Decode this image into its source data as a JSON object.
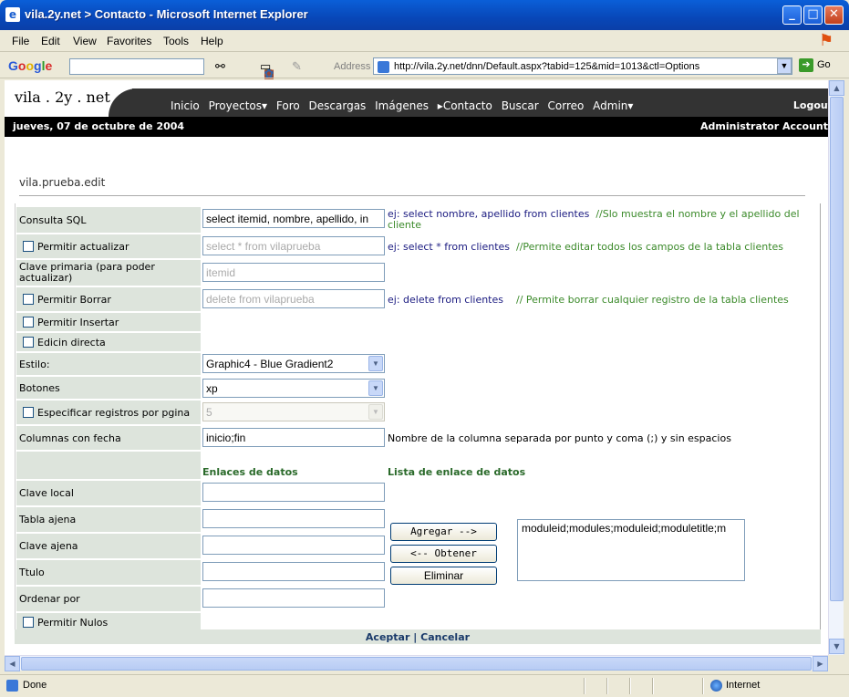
{
  "window": {
    "title": "vila.2y.net > Contacto - Microsoft Internet Explorer",
    "min": "_",
    "max": "□",
    "close": "✕"
  },
  "menu": [
    "File",
    "Edit",
    "View",
    "Favorites",
    "Tools",
    "Help"
  ],
  "google": {
    "label": "Google"
  },
  "address": {
    "label": "Address",
    "url": "http://vila.2y.net/dnn/Default.aspx?tabid=125&mid=1013&ctl=Options",
    "go": "Go"
  },
  "site": {
    "name": "vila . 2y . net",
    "nav": [
      "Inicio",
      "Proyectos▾",
      "Foro",
      "Descargas",
      "Imágenes",
      "▸Contacto",
      "Buscar",
      "Correo",
      "Admin▾"
    ],
    "logout": "Logout",
    "date": "jueves, 07 de octubre de 2004",
    "account": "Administrator Account"
  },
  "module": {
    "title": "vila.prueba.edit"
  },
  "form": {
    "consulta_label": "Consulta SQL",
    "consulta_value": "select itemid, nombre, apellido, in",
    "consulta_ej_prefix": "ej:",
    "consulta_ej_q": "select nombre, apellido from clientes",
    "consulta_ej_c": "//Slo muestra el nombre y el apellido del",
    "consulta_ej_c2": "cliente",
    "actualizar_label": "Permitir actualizar",
    "actualizar_value": "select * from vilaprueba",
    "actualizar_ej_q": "select * from clientes",
    "actualizar_ej_c": "//Permite editar todos los campos de la tabla clientes",
    "clave_label": "Clave primaria (para poder actualizar)",
    "clave_value": "itemid",
    "borrar_label": "Permitir Borrar",
    "borrar_value": "delete from vilaprueba",
    "borrar_ej_q": "delete from clientes",
    "borrar_ej_c": "// Permite borrar cualquier registro de la tabla clientes",
    "insertar_label": "Permitir Insertar",
    "edicion_label": "Edicin directa",
    "estilo_label": "Estilo:",
    "estilo_value": "Graphic4 - Blue Gradient2",
    "botones_label": "Botones",
    "botones_value": "xp",
    "registros_label": "Especificar registros por pgina",
    "registros_value": "5",
    "fecha_label": "Columnas con fecha",
    "fecha_value": "inicio;fin",
    "fecha_help": "Nombre de la columna separada por punto y coma (;) y sin espacios",
    "enlaces_hdr": "Enlaces de datos",
    "lista_hdr": "Lista de enlace de datos",
    "clave_local_label": "Clave local",
    "tabla_ajena_label": "Tabla ajena",
    "clave_ajena_label": "Clave ajena",
    "titulo_label": "Ttulo",
    "ordenar_label": "Ordenar por",
    "nulos_label": "Permitir Nulos",
    "agregar_btn": "Agregar -->",
    "obtener_btn": "<-- Obtener",
    "eliminar_btn": "Eliminar",
    "lista_value": "moduleid;modules;moduleid;moduletitle;m",
    "aceptar": "Aceptar",
    "sep": "|",
    "cancelar": "Cancelar"
  },
  "status": {
    "text": "Done",
    "zone": "Internet"
  }
}
